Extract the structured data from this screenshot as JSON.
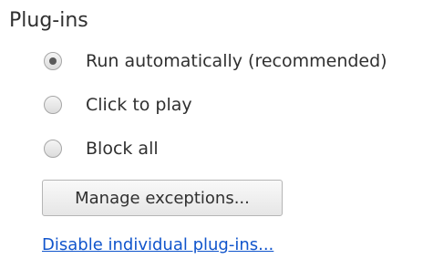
{
  "section": {
    "title": "Plug-ins"
  },
  "options": [
    {
      "label": "Run automatically (recommended)",
      "checked": true
    },
    {
      "label": "Click to play",
      "checked": false
    },
    {
      "label": "Block all",
      "checked": false
    }
  ],
  "buttons": {
    "manage_exceptions": "Manage exceptions..."
  },
  "links": {
    "disable_individual": "Disable individual plug-ins..."
  },
  "colors": {
    "link": "#1155cc",
    "text": "#303030"
  }
}
